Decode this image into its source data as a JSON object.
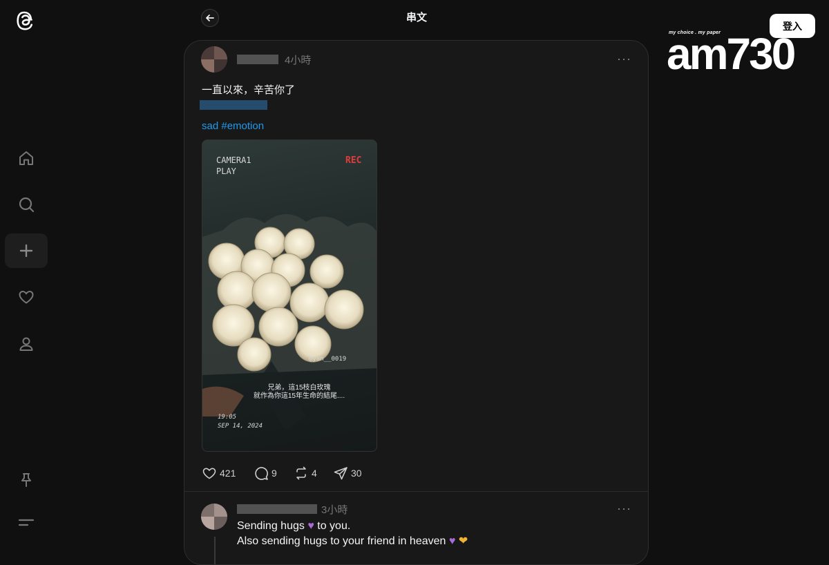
{
  "header": {
    "title": "串文",
    "login_label": "登入"
  },
  "brand": {
    "tagline": "my choice . my paper",
    "name": "am730"
  },
  "sidebar": {
    "items": [
      {
        "icon": "home-icon"
      },
      {
        "icon": "search-icon"
      },
      {
        "icon": "plus-icon"
      },
      {
        "icon": "heart-icon"
      },
      {
        "icon": "profile-icon"
      },
      {
        "icon": "pin-icon"
      },
      {
        "icon": "menu-icon"
      }
    ]
  },
  "post": {
    "time": "4小時",
    "more": "···",
    "text": "一直以來，辛苦你了",
    "tag_line": "sad #emotion",
    "photo": {
      "camera_label": "CAMERA1",
      "play_label": "PLAY",
      "rec_label": "REC",
      "watermark": "@yan__0019",
      "caption_line1": "兄弟，這15枝白玫瑰",
      "caption_line2": "就作為你這15年生命的結尾....",
      "time_stamp": "19:05",
      "date_stamp": "SEP  14,  2024"
    },
    "likes": "421",
    "comments": "9",
    "reposts": "4",
    "shares": "30"
  },
  "reply": {
    "time": "3小時",
    "more": "···",
    "line1_a": "Sending hugs",
    "line1_b": "to you.",
    "line2": "Also sending hugs to your friend in heaven"
  }
}
